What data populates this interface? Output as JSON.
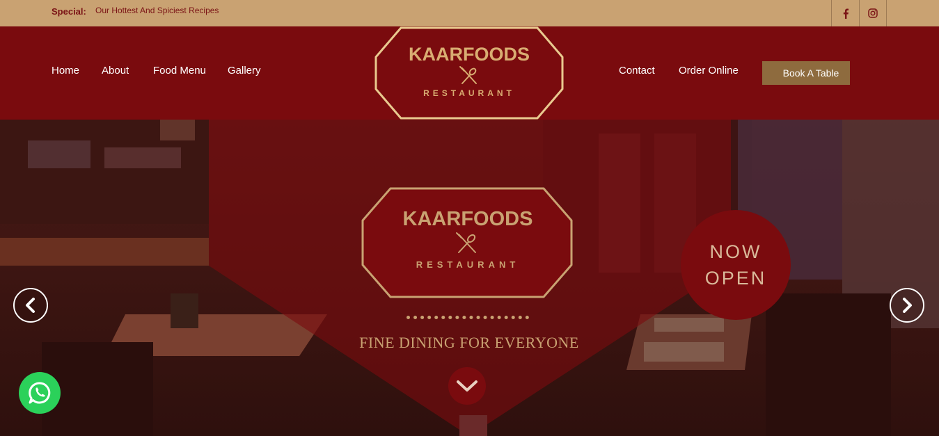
{
  "topbar": {
    "special_label": "Special:",
    "special_text": "Our Hottest And Spiciest Recipes",
    "social": [
      {
        "icon": "facebook-icon",
        "glyph": "f"
      },
      {
        "icon": "instagram-icon"
      }
    ]
  },
  "nav": {
    "left": [
      "Home",
      "About",
      "Food Menu",
      "Gallery"
    ],
    "right": [
      "Contact",
      "Order Online"
    ],
    "book_label": "Book A Table"
  },
  "logo": {
    "name": "KAARFOODS",
    "sub": "RESTAURANT"
  },
  "hero": {
    "logo_name": "KAARFOODS",
    "logo_sub": "RESTAURANT",
    "tagline": "FINE DINING FOR EVERYONE",
    "badge_line1": "NOW",
    "badge_line2": "OPEN"
  },
  "colors": {
    "topbar": "#c9a272",
    "nav": "#7a0b0e",
    "gold": "#c9a272",
    "button": "#8e6b3e",
    "whatsapp": "#2bd15a"
  }
}
